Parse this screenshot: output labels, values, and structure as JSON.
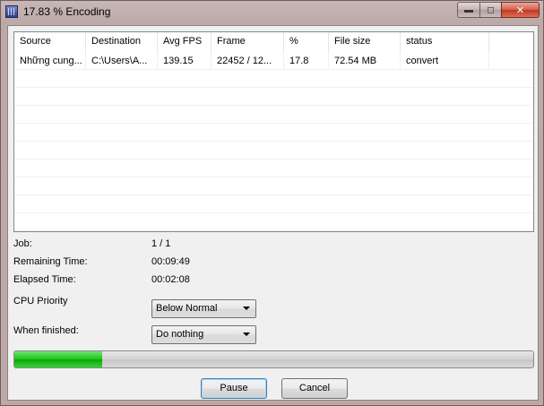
{
  "window": {
    "title": "17.83 % Encoding"
  },
  "table": {
    "columns": [
      "Source",
      "Destination",
      "Avg FPS",
      "Frame",
      "%",
      "File size",
      "status",
      ""
    ],
    "rows": [
      [
        "Những cung...",
        "C:\\Users\\A...",
        "139.15",
        "22452 / 12...",
        "17.8",
        "72.54 MB",
        "convert",
        ""
      ]
    ]
  },
  "info": {
    "job_label": "Job:",
    "job_value": "1 / 1",
    "remaining_label": "Remaining Time:",
    "remaining_value": "00:09:49",
    "elapsed_label": "Elapsed Time:",
    "elapsed_value": "00:02:08"
  },
  "cpu_priority": {
    "label": "CPU Priority",
    "selected": "Below Normal"
  },
  "when_finished": {
    "label": "When finished:",
    "selected": "Do nothing"
  },
  "progress": {
    "fraction": 0.17
  },
  "buttons": {
    "pause": "Pause",
    "cancel": "Cancel"
  },
  "icons": [
    "app-icon",
    "minimize-icon",
    "maximize-icon",
    "close-icon",
    "dropdown-arrow-icon"
  ]
}
